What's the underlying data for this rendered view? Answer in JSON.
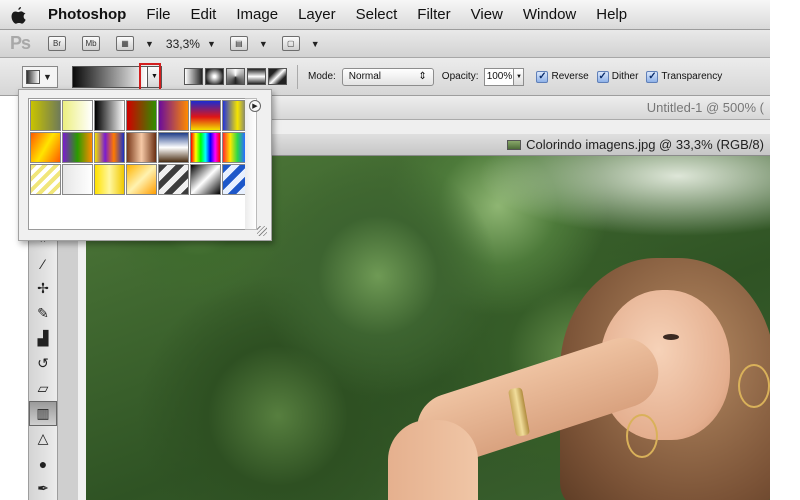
{
  "menubar": {
    "app_name": "Photoshop",
    "items": [
      "File",
      "Edit",
      "Image",
      "Layer",
      "Select",
      "Filter",
      "View",
      "Window",
      "Help"
    ]
  },
  "appbar": {
    "logo": "Ps",
    "bridge": "Br",
    "mini_bridge": "Mb",
    "zoom": "33,3%"
  },
  "options": {
    "mode_label": "Mode:",
    "mode_value": "Normal",
    "opacity_label": "Opacity:",
    "opacity_value": "100%",
    "reverse_label": "Reverse",
    "dither_label": "Dither",
    "transparency_label": "Transparency",
    "reverse_checked": true,
    "dither_checked": true,
    "transparency_checked": true
  },
  "documents": {
    "untitled_tab": "Untitled-1 @ 500% (",
    "active_tab": "Colorindo imagens.jpg @ 33,3% (RGB/8)"
  },
  "gradient_presets": [
    {
      "name": "yellow-gray",
      "css": "linear-gradient(90deg,#c9c300,#6f7b58)"
    },
    {
      "name": "foreground-transparent",
      "css": "linear-gradient(90deg,#ecef80,#ffffff)"
    },
    {
      "name": "black-white",
      "css": "linear-gradient(90deg,#000000,#ffffff)"
    },
    {
      "name": "red-green",
      "css": "linear-gradient(90deg,#d10000,#2f8f00)"
    },
    {
      "name": "violet-orange",
      "css": "linear-gradient(90deg,#6a0c9b,#ff8a00)"
    },
    {
      "name": "blue-red-yellow",
      "css": "linear-gradient(180deg,#1b2bd0,#e01515 55%,#f3e100)"
    },
    {
      "name": "blue-yellow-blue",
      "css": "linear-gradient(90deg,#2334d8,#f5e400 50%,#2334d8)"
    },
    {
      "name": "orange-yellow-orange",
      "css": "linear-gradient(120deg,#ff5a00,#ffe400 50%,#ff5a00)"
    },
    {
      "name": "violet-green-orange",
      "css": "linear-gradient(90deg,#7a1ccf,#2a9b00 50%,#ff8b00)"
    },
    {
      "name": "yellow-violet-orange-blue",
      "css": "linear-gradient(90deg,#f2e300,#7a1ccf 35%,#ff7b00 65%,#1930c7)"
    },
    {
      "name": "copper",
      "css": "linear-gradient(90deg,#7a3a1a,#f6c9a6 50%,#6b2f13)"
    },
    {
      "name": "chrome",
      "css": "linear-gradient(180deg,#1f3d88,#ffffff 50%,#4a2d12)"
    },
    {
      "name": "spectrum",
      "css": "linear-gradient(90deg,#ff0000,#ffff00,#00ff00,#00ffff,#0000ff,#ff00ff,#ff0000)"
    },
    {
      "name": "transparent-rainbow",
      "css": "linear-gradient(90deg,#ff2a2a,#ffe600,#2ad84a,#2a6dff,#c12aff)"
    },
    {
      "name": "transparent-stripes",
      "css": "repeating-linear-gradient(135deg,#f1e67a 0 4px,#ffffff 4px 8px)"
    },
    {
      "name": "neutral-density",
      "css": "linear-gradient(90deg,#e6e6e6,#ffffff)"
    },
    {
      "name": "yellow-gold",
      "css": "linear-gradient(90deg,#ffe100,#fff7a0 50%,#f0c800)"
    },
    {
      "name": "orange-gold",
      "css": "linear-gradient(135deg,#ffb300,#fff2b0 50%,#ff9d00)"
    },
    {
      "name": "silver-stripes",
      "css": "repeating-linear-gradient(135deg,#3c3c3c 0 6px,#f0f0f0 6px 12px)"
    },
    {
      "name": "black-white-black",
      "css": "linear-gradient(135deg,#000000,#ffffff 50%,#000000)"
    },
    {
      "name": "blue-stripes",
      "css": "repeating-linear-gradient(135deg,#1d57c9 0 6px,#e7f0ff 6px 12px)"
    }
  ],
  "tools": [
    {
      "name": "crop-tool",
      "glyph": "⌗"
    },
    {
      "name": "eyedropper-tool",
      "glyph": "⁄"
    },
    {
      "name": "spot-healing-tool",
      "glyph": "✢"
    },
    {
      "name": "brush-tool",
      "glyph": "✎"
    },
    {
      "name": "clone-stamp-tool",
      "glyph": "▟"
    },
    {
      "name": "history-brush-tool",
      "glyph": "↺"
    },
    {
      "name": "eraser-tool",
      "glyph": "▱"
    },
    {
      "name": "gradient-tool",
      "glyph": "▥"
    },
    {
      "name": "blur-tool",
      "glyph": "△"
    },
    {
      "name": "dodge-tool",
      "glyph": "●"
    },
    {
      "name": "pen-tool",
      "glyph": "✒"
    }
  ]
}
